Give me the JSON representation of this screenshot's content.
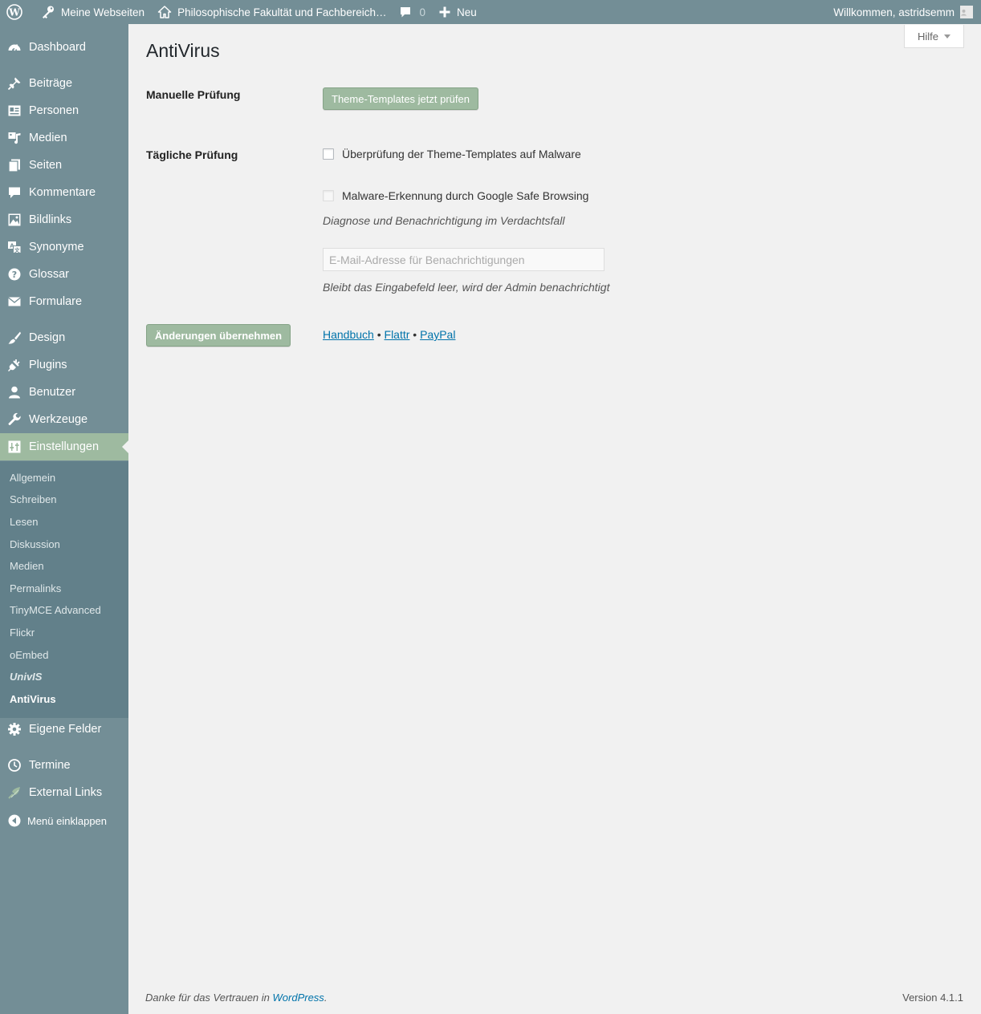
{
  "adminbar": {
    "my_sites": "Meine Webseiten",
    "site_name": "Philosophische Fakultät und Fachbereich…",
    "comments_count": "0",
    "new_label": "Neu",
    "welcome": "Willkommen, astridsemm"
  },
  "sidebar": {
    "items": [
      {
        "label": "Dashboard",
        "icon": "dashboard-icon"
      },
      {
        "label": "Beiträge",
        "icon": "pin-icon"
      },
      {
        "label": "Personen",
        "icon": "id-card-icon"
      },
      {
        "label": "Medien",
        "icon": "media-icon"
      },
      {
        "label": "Seiten",
        "icon": "pages-icon"
      },
      {
        "label": "Kommentare",
        "icon": "comment-icon"
      },
      {
        "label": "Bildlinks",
        "icon": "image-icon"
      },
      {
        "label": "Synonyme",
        "icon": "translate-icon"
      },
      {
        "label": "Glossar",
        "icon": "help-icon"
      },
      {
        "label": "Formulare",
        "icon": "envelope-icon"
      },
      {
        "label": "Design",
        "icon": "brush-icon"
      },
      {
        "label": "Plugins",
        "icon": "plug-icon"
      },
      {
        "label": "Benutzer",
        "icon": "user-icon"
      },
      {
        "label": "Werkzeuge",
        "icon": "wrench-icon"
      },
      {
        "label": "Einstellungen",
        "icon": "settings-icon"
      },
      {
        "label": "Eigene Felder",
        "icon": "gear-icon"
      },
      {
        "label": "Termine",
        "icon": "clock-icon"
      },
      {
        "label": "External Links",
        "icon": "link-icon"
      },
      {
        "label": "Menü einklappen",
        "icon": "collapse-icon"
      }
    ],
    "submenu": [
      "Allgemein",
      "Schreiben",
      "Lesen",
      "Diskussion",
      "Medien",
      "Permalinks",
      "TinyMCE Advanced",
      "Flickr",
      "oEmbed",
      "UnivIS",
      "AntiVirus"
    ]
  },
  "help_tab": "Hilfe",
  "page": {
    "title": "AntiVirus",
    "manual_label": "Manuelle Prüfung",
    "manual_button": "Theme-Templates jetzt prüfen",
    "daily_label": "Tägliche Prüfung",
    "check_templates": "Überprüfung der Theme-Templates auf Malware",
    "check_safe_browsing": "Malware-Erkennung durch Google Safe Browsing",
    "diagnose_desc": "Diagnose und Benachrichtigung im Verdachtsfall",
    "email_placeholder": "E-Mail-Adresse für Benachrichtigungen",
    "email_desc": "Bleibt das Eingabefeld leer, wird der Admin benachrichtigt",
    "save_button": "Änderungen übernehmen",
    "links": {
      "handbook": "Handbuch",
      "flattr": "Flattr",
      "paypal": "PayPal",
      "separator": "•"
    }
  },
  "footer": {
    "thanks_prefix": "Danke für das Vertrauen in",
    "wordpress": "WordPress",
    "period": ".",
    "version": "Version 4.1.1"
  },
  "colors": {
    "adminbar": "#738e96",
    "sidebar": "#738e96",
    "submenu": "#62808a",
    "accent": "#9ebaa0",
    "link": "#0073aa"
  }
}
